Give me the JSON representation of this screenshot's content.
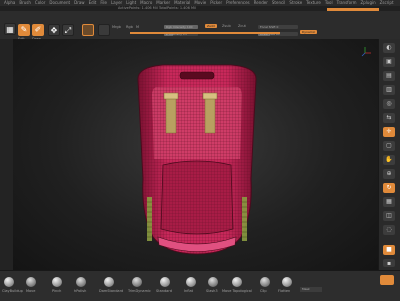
{
  "app": {
    "menu_items": [
      "Alpha",
      "Brush",
      "Color",
      "Document",
      "Draw",
      "Edit",
      "File",
      "Layer",
      "Light",
      "Macro",
      "Marker",
      "Material",
      "Movie",
      "Picker",
      "Preferences",
      "Render",
      "Stencil",
      "Stroke",
      "Texture",
      "Tool",
      "Transform",
      "Zplugin",
      "Zscript"
    ],
    "license_text": "",
    "info_text": "ActivePoints: 1.406 Mil  TotalPoints: 1.406 Mil"
  },
  "toolbar": {
    "buttons": [
      {
        "label": "Edit",
        "active": true
      },
      {
        "label": "Draw",
        "active": true
      },
      {
        "label": "Move",
        "active": false
      },
      {
        "label": "Scale",
        "active": false
      },
      {
        "label": "Rotate",
        "active": false
      }
    ],
    "mrgb": "Mrgb",
    "rgb": "Rgb",
    "m": "M",
    "zadd": "Zadd",
    "zsub": "Zsub",
    "zcut": "Zcut",
    "focal_shift_label": "Focal Shift 0",
    "draw_size_label": "Draw Size 64",
    "rgb_intensity_label": "Rgb Intensity 100",
    "z_intensity_label": "Z Intensity 25",
    "dynamic_label": "Dynamic"
  },
  "right_tray": {
    "buttons": [
      "BPR",
      "SPix 3",
      "Persp",
      "Floor",
      "Local",
      "LSym",
      "Xyz",
      "Frame",
      "Move",
      "Scale",
      "Rotate",
      "Line Fill",
      "Transp",
      "Ghost",
      "Solo",
      "Xpose"
    ]
  },
  "brushes": [
    {
      "label": "ClayBuildup"
    },
    {
      "label": "Move"
    },
    {
      "label": "Pinch"
    },
    {
      "label": "hPolish"
    },
    {
      "label": "DamStandard"
    },
    {
      "label": "TrimDynamic"
    },
    {
      "label": "Standard"
    },
    {
      "label": "Inflat"
    },
    {
      "label": "Slash3"
    },
    {
      "label": "Move Topological"
    },
    {
      "label": "Clip"
    },
    {
      "label": "Flatten"
    }
  ],
  "bottom_tray": {
    "mode_label": "Mask"
  },
  "colors": {
    "accent": "#e08a3a",
    "mesh": "#c8285a",
    "mesh_dark": "#7a1030",
    "strap": "#b8a060"
  }
}
